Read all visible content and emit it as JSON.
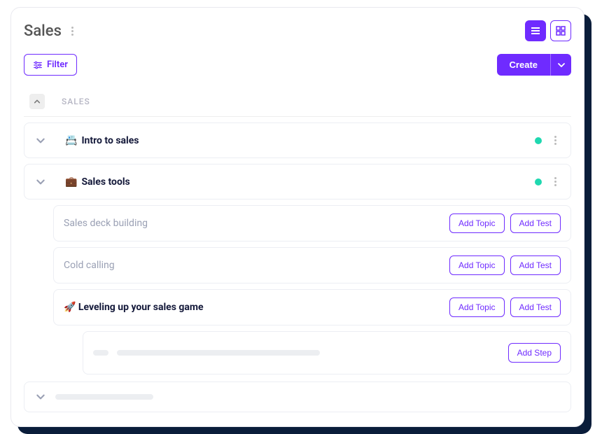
{
  "header": {
    "title": "Sales"
  },
  "toolbar": {
    "filter_label": "Filter",
    "create_label": "Create"
  },
  "section": {
    "name": "SALES"
  },
  "courses": [
    {
      "emoji": "📇",
      "title": "Intro to sales",
      "status": "active"
    },
    {
      "emoji": "💼",
      "title": "Sales tools",
      "status": "active"
    }
  ],
  "topics": [
    {
      "title": "Sales deck building",
      "bold": false
    },
    {
      "title": "Cold calling",
      "bold": false
    },
    {
      "title": "Leveling up your sales game",
      "emoji": "🚀",
      "bold": true
    }
  ],
  "buttons": {
    "add_topic": "Add Topic",
    "add_test": "Add Test",
    "add_step": "Add Step"
  }
}
